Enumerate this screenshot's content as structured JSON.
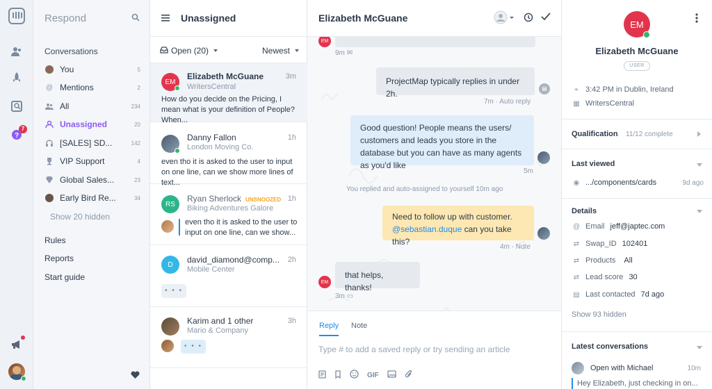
{
  "rail": {
    "icons": [
      "intercom-logo-icon",
      "contacts-icon",
      "rocket-icon",
      "inbox-icon",
      "help-icon",
      "megaphone-icon",
      "user-avatar"
    ],
    "help_badge": "7"
  },
  "nav": {
    "title": "Respond",
    "conversations_heading": "Conversations",
    "items": [
      {
        "label": "You",
        "count": "5",
        "icon": "avatar"
      },
      {
        "label": "Mentions",
        "count": "2",
        "icon": "at-icon"
      },
      {
        "label": "All",
        "count": "234",
        "icon": "team-icon"
      },
      {
        "label": "Unassigned",
        "count": "20",
        "icon": "unassigned-icon"
      },
      {
        "label": "[SALES] SD...",
        "count": "142",
        "icon": "headset-icon"
      },
      {
        "label": "VIP Support",
        "count": "4",
        "icon": "trophy-icon"
      },
      {
        "label": "Global Sales...",
        "count": "23",
        "icon": "diamond-icon"
      },
      {
        "label": "Early Bird Re...",
        "count": "34",
        "icon": "avatar"
      }
    ],
    "show_hidden": "Show 20 hidden",
    "links": [
      "Rules",
      "Reports",
      "Start guide"
    ]
  },
  "list": {
    "title": "Unassigned",
    "filter": "Open (20)",
    "sort": "Newest",
    "conversations": [
      {
        "initials": "EM",
        "name": "Elizabeth McGuane",
        "company": "WritersCentral",
        "time": "3m",
        "snippet": "How do you decide on the Pricing, I mean what is your definition of People? When...",
        "color": "#e3344d"
      },
      {
        "name": "Danny Fallon",
        "company": "London Moving Co.",
        "time": "1h",
        "snippet": "even tho it is asked to the user to input on one line, can we show more lines of text..."
      },
      {
        "initials": "RS",
        "name": "Ryan Sherlock",
        "tag": "UNSNOOZED",
        "company": "Biking Adventures Galore",
        "time": "1h",
        "snippet": "even tho it is asked to the user to input on one line, can we show...",
        "color": "#2bb58a"
      },
      {
        "initials": "D",
        "name": "david_diamond@comp...",
        "company": "Mobile Center",
        "time": "2h",
        "typing": "• • •",
        "color": "#33b8e6"
      },
      {
        "name": "Karim and 1 other",
        "company": "Mario & Company",
        "time": "3h",
        "typing": "• • •"
      }
    ]
  },
  "thread": {
    "title": "Elizabeth McGuane",
    "messages": [
      {
        "meta": "9m"
      },
      {
        "text": "ProjectMap typically replies in under 2h.",
        "meta": "7m · Auto reply"
      },
      {
        "text": "Good question! People means the users/ customers and leads you store in the database but you can have as many agents as you'd like",
        "meta": "5m"
      },
      {
        "event": "You replied and auto-assigned to yourself 10m ago"
      },
      {
        "note_text": "Need to follow up with customer.",
        "mention": "@sebastian.duque",
        "note_tail": " can you take this?",
        "meta": "4m · Note"
      },
      {
        "text": "that helps, thanks!",
        "meta": "3m"
      }
    ],
    "composer": {
      "tab_reply": "Reply",
      "tab_note": "Note",
      "placeholder": "Type # to add a saved reply or try sending an article",
      "tools": [
        "article-icon",
        "bookmark-icon",
        "emoji-icon",
        "GIF",
        "image-icon",
        "attachment-icon"
      ]
    }
  },
  "details": {
    "initials": "EM",
    "name": "Elizabeth McGuane",
    "role": "USER",
    "local_time": "3:42 PM in Dublin, Ireland",
    "company": "WritersCentral",
    "qualification_label": "Qualification",
    "qualification_value": "11/12 complete",
    "last_viewed_label": "Last viewed",
    "last_viewed_page": ".../components/cards",
    "last_viewed_time": "9d ago",
    "details_label": "Details",
    "fields": [
      {
        "key": "Email",
        "value": "jeff@japtec.com"
      },
      {
        "key": "Swap_ID",
        "value": "102401"
      },
      {
        "key": "Products",
        "value": "All"
      },
      {
        "key": "Lead score",
        "value": "30"
      },
      {
        "key": "Last contacted",
        "value": "7d ago"
      }
    ],
    "show_hidden": "Show 93 hidden",
    "latest_label": "Latest conversations",
    "latest_status": "Open with Michael",
    "latest_time": "10m",
    "latest_snippet": "Hey Elizabeth, just checking in on..."
  },
  "colors": {
    "accent_blue": "#1f8ceb",
    "accent_purple": "#8b5cf6",
    "danger_red": "#e3344d",
    "online_green": "#35b56a",
    "note_yellow": "#fde8b3"
  }
}
